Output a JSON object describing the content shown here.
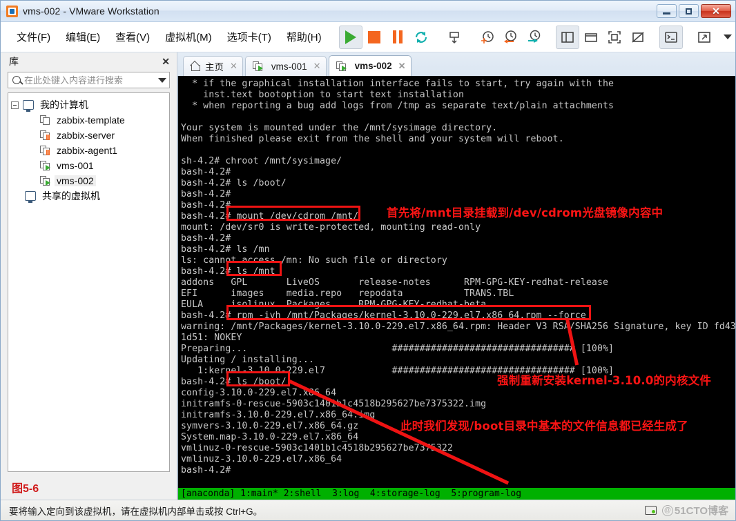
{
  "window": {
    "title": "vms-002 - VMware Workstation",
    "app_icon": "vmware-icon",
    "minimize_label": "–",
    "maximize_label": "□",
    "close_label": "✕"
  },
  "menubar": {
    "items": [
      {
        "label": "文件(F)",
        "name": "menu-file"
      },
      {
        "label": "编辑(E)",
        "name": "menu-edit"
      },
      {
        "label": "查看(V)",
        "name": "menu-view"
      },
      {
        "label": "虚拟机(M)",
        "name": "menu-vm"
      },
      {
        "label": "选项卡(T)",
        "name": "menu-tabs"
      },
      {
        "label": "帮助(H)",
        "name": "menu-help"
      }
    ],
    "toolbar_icons": [
      "power-on-icon",
      "power-off-icon",
      "suspend-icon",
      "reset-icon",
      "snapshot-icon",
      "take-snapshot-icon",
      "revert-snapshot-icon",
      "snapshot-manager-icon",
      "show-library-icon",
      "show-thumbnails-icon",
      "full-screen-icon",
      "unity-mode-icon",
      "console-view-icon",
      "expand-icon",
      "more-icon"
    ]
  },
  "sidebar": {
    "title": "库",
    "close_label": "✕",
    "search": {
      "placeholder": "在此处键入内容进行搜索",
      "value": ""
    },
    "tree": [
      {
        "label": "我的计算机",
        "icon": "host-icon",
        "level": 0,
        "state": "expanded"
      },
      {
        "label": "zabbix-template",
        "icon": "vm-icon",
        "level": 1,
        "state": "off"
      },
      {
        "label": "zabbix-server",
        "icon": "vm-icon",
        "level": 1,
        "state": "suspended"
      },
      {
        "label": "zabbix-agent1",
        "icon": "vm-icon",
        "level": 1,
        "state": "suspended"
      },
      {
        "label": "vms-001",
        "icon": "vm-icon",
        "level": 1,
        "state": "running"
      },
      {
        "label": "vms-002",
        "icon": "vm-icon",
        "level": 1,
        "state": "running",
        "selected": true
      },
      {
        "label": "共享的虚拟机",
        "icon": "shared-vm-icon",
        "level": 0
      }
    ],
    "figure_label": "图5-6"
  },
  "tabs": [
    {
      "label": "主页",
      "icon": "home-icon",
      "active": false,
      "close": "✕"
    },
    {
      "label": "vms-001",
      "icon": "vm-running-icon",
      "active": false,
      "close": "✕"
    },
    {
      "label": "vms-002",
      "icon": "vm-running-icon",
      "active": true,
      "close": "✕"
    }
  ],
  "terminal": {
    "lines": [
      "  * if the graphical installation interface fails to start, try again with the",
      "    inst.text bootoption to start text installation",
      "  * when reporting a bug add logs from /tmp as separate text/plain attachments",
      "",
      "Your system is mounted under the /mnt/sysimage directory.",
      "When finished please exit from the shell and your system will reboot.",
      "",
      "sh-4.2# chroot /mnt/sysimage/",
      "bash-4.2#",
      "bash-4.2# ls /boot/",
      "bash-4.2#",
      "bash-4.2#",
      "bash-4.2# mount /dev/cdrom /mnt/",
      "mount: /dev/sr0 is write-protected, mounting read-only",
      "bash-4.2#",
      "bash-4.2# ls /mn",
      "ls: cannot access /mn: No such file or directory",
      "bash-4.2# ls /mnt",
      "addons   GPL       LiveOS       release-notes      RPM-GPG-KEY-redhat-release",
      "EFI      images    media.repo   repodata           TRANS.TBL",
      "EULA     isolinux  Packages     RPM-GPG-KEY-redhat-beta",
      "bash-4.2# rpm -ivh /mnt/Packages/kernel-3.10.0-229.el7.x86_64.rpm --force",
      "warning: /mnt/Packages/kernel-3.10.0-229.el7.x86_64.rpm: Header V3 RSA/SHA256 Signature, key ID fd43",
      "1d51: NOKEY",
      "Preparing...                          ################################# [100%]",
      "Updating / installing...",
      "   1:kernel-3.10.0-229.el7            ################################# [100%]",
      "bash-4.2# ls /boot/",
      "config-3.10.0-229.el7.x86_64",
      "initramfs-0-rescue-5903c1401b1c4518b295627be7375322.img",
      "initramfs-3.10.0-229.el7.x86_64.img",
      "symvers-3.10.0-229.el7.x86_64.gz",
      "System.map-3.10.0-229.el7.x86_64",
      "vmlinuz-0-rescue-5903c1401b1c4518b295627be7375322",
      "vmlinuz-3.10.0-229.el7.x86_64",
      "bash-4.2#"
    ],
    "status_line": "[anaconda] 1:main* 2:shell  3:log  4:storage-log  5:program-log",
    "colors": {
      "bg": "#000000",
      "fg": "#c8c8c8",
      "status_bg": "#00b000",
      "status_fg": "#000000"
    }
  },
  "annotations": {
    "accent_color": "#ef1313",
    "notes": [
      {
        "name": "annotation-mount",
        "text": "首先将/mnt目录挂载到/dev/cdrom光盘镜像内容中"
      },
      {
        "name": "annotation-rpm-force",
        "text": "强制重新安装kernel-3.10.0的内核文件"
      },
      {
        "name": "annotation-boot-files",
        "text": "此时我们发现/boot目录中基本的文件信息都已经生成了"
      }
    ],
    "highlight_boxes": [
      "mount-command-box",
      "ls-mnt-box",
      "rpm-command-box",
      "ls-boot-box"
    ]
  },
  "statusbar": {
    "message": "要将输入定向到该虚拟机，请在虚拟机内部单击或按 Ctrl+G。",
    "watermark": "51CTO博客",
    "icons": [
      "network-status-icon",
      "at-icon"
    ]
  }
}
